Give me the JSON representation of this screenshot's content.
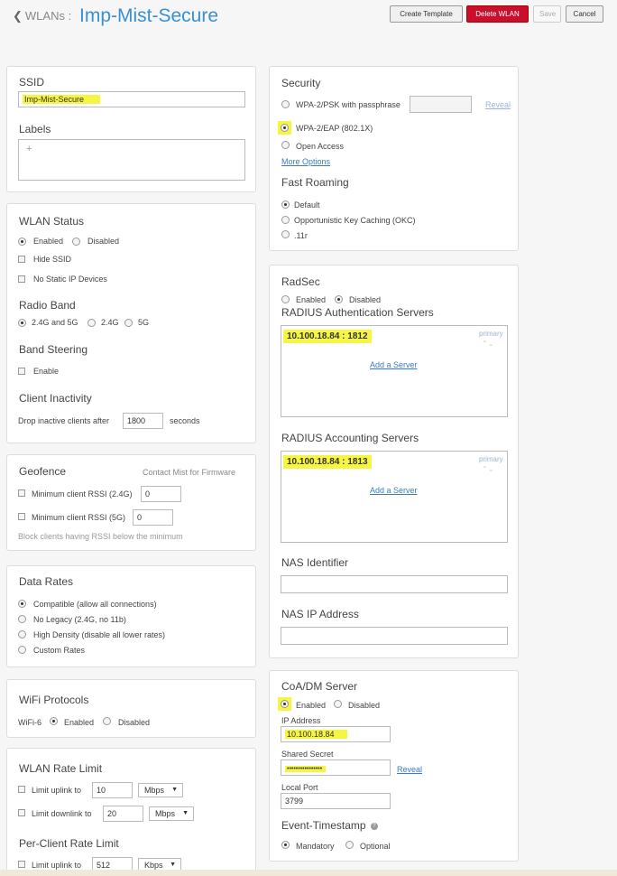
{
  "header": {
    "breadcrumb": "WLANs :",
    "title": "Imp-Mist-Secure",
    "buttons": {
      "create_template": "Create Template",
      "delete_wlan": "Delete WLAN",
      "save": "Save",
      "cancel": "Cancel"
    }
  },
  "ssid": {
    "label": "SSID",
    "value": "Imp-Mist-Secure",
    "labels_title": "Labels",
    "add_symbol": "+"
  },
  "wlan_status": {
    "title": "WLAN Status",
    "enabled": "Enabled",
    "disabled": "Disabled",
    "hide_ssid": "Hide SSID",
    "no_static_ip": "No Static IP Devices",
    "radio_band_title": "Radio Band",
    "band_both": "2.4G and 5G",
    "band_24": "2.4G",
    "band_5": "5G",
    "band_steering_title": "Band Steering",
    "band_steering_enable": "Enable",
    "client_inactivity_title": "Client Inactivity",
    "drop_label": "Drop inactive clients after",
    "drop_value": "1800",
    "drop_unit": "seconds"
  },
  "geofence": {
    "title": "Geofence",
    "contact": "Contact Mist for Firmware",
    "rssi24_label": "Minimum client RSSI (2.4G)",
    "rssi24_value": "0",
    "rssi5_label": "Minimum client RSSI (5G)",
    "rssi5_value": "0",
    "note": "Block clients having RSSI below the minimum"
  },
  "data_rates": {
    "title": "Data Rates",
    "options": [
      "Compatible (allow all connections)",
      "No Legacy (2.4G, no 11b)",
      "High Density (disable all lower rates)",
      "Custom Rates"
    ]
  },
  "wifi_protocols": {
    "title": "WiFi Protocols",
    "label": "WiFi-6",
    "enabled": "Enabled",
    "disabled": "Disabled"
  },
  "wlan_rate_limit": {
    "title": "WLAN Rate Limit",
    "uplink_label": "Limit uplink to",
    "uplink_value": "10",
    "uplink_unit": "Mbps",
    "downlink_label": "Limit downlink to",
    "downlink_value": "20",
    "downlink_unit": "Mbps",
    "per_client_title": "Per-Client Rate Limit",
    "pc_uplink_label": "Limit uplink to",
    "pc_uplink_value": "512",
    "pc_uplink_unit": "Kbps"
  },
  "security": {
    "title": "Security",
    "psk": "WPA-2/PSK with passphrase",
    "reveal": "Reveal",
    "eap": "WPA-2/EAP (802.1X)",
    "open": "Open Access",
    "more": "More Options",
    "fast_roaming_title": "Fast Roaming",
    "fr_default": "Default",
    "fr_okc": "Opportunistic Key Caching (OKC)",
    "fr_11r": ".11r"
  },
  "radsec": {
    "title": "RadSec",
    "enabled": "Enabled",
    "disabled": "Disabled",
    "auth_title": "RADIUS Authentication Servers",
    "auth_server": "10.100.18.84 : 1812",
    "primary": "primary",
    "add_server": "Add a Server",
    "acct_title": "RADIUS Accounting Servers",
    "acct_server": "10.100.18.84 : 1813",
    "nas_id_title": "NAS Identifier",
    "nas_ip_title": "NAS IP Address"
  },
  "coa": {
    "title": "CoA/DM Server",
    "enabled": "Enabled",
    "disabled": "Disabled",
    "ip_label": "IP Address",
    "ip_value": "10.100.18.84",
    "secret_label": "Shared Secret",
    "secret_value": "••••••••••••••••",
    "reveal": "Reveal",
    "port_label": "Local Port",
    "port_value": "3799",
    "event_title": "Event-Timestamp",
    "help": "?",
    "mandatory": "Mandatory",
    "optional": "Optional"
  },
  "colors": {
    "accent": "#3a8fd6",
    "danger": "#c8102e",
    "highlight": "#f5f542"
  }
}
